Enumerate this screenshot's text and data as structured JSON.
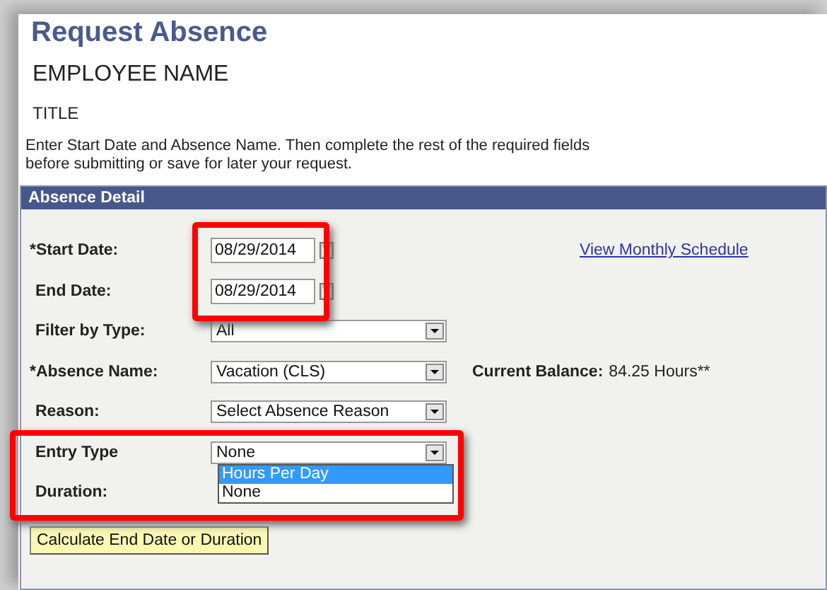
{
  "page": {
    "title": "Request Absence",
    "employee_name": "EMPLOYEE NAME",
    "employee_title": "TITLE",
    "instructions": "Enter Start Date and Absence Name. Then complete the rest of the required fields\nbefore submitting or save for later your request."
  },
  "panel": {
    "header": "Absence Detail",
    "fields": [
      {
        "kind": "date",
        "label": "*Start Date:",
        "value": "08/29/2014",
        "link": "View Monthly Schedule"
      },
      {
        "kind": "date",
        "label": "End Date:",
        "value": "08/29/2014"
      },
      {
        "kind": "select",
        "label": "Filter by Type:",
        "value": "All"
      },
      {
        "kind": "select",
        "label": "*Absence Name:",
        "value": "Vacation (CLS)",
        "note_label": "Current Balance:",
        "note_value": "84.25 Hours**"
      },
      {
        "kind": "select",
        "label": "Reason:",
        "value": "Select Absence Reason"
      },
      {
        "kind": "select",
        "label": "Entry Type",
        "value": "None",
        "open": true,
        "options": [
          {
            "label": "Hours Per Day",
            "highlighted": true
          },
          {
            "label": "None",
            "highlighted": false
          }
        ]
      },
      {
        "kind": "blank",
        "label": "Duration:"
      }
    ],
    "button": "Calculate End Date or Duration"
  }
}
